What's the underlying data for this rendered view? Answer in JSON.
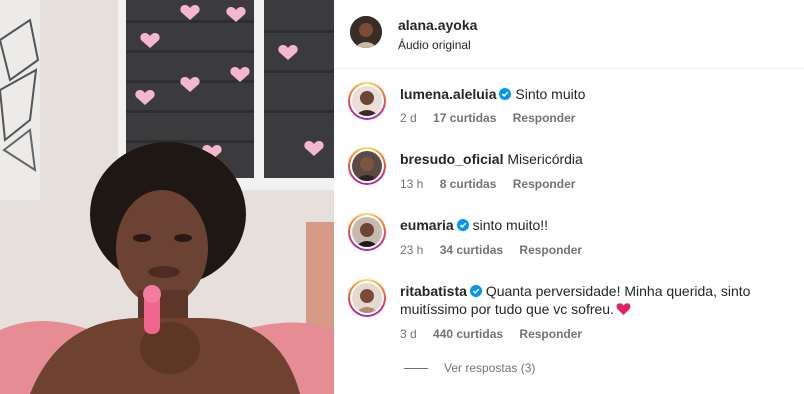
{
  "header": {
    "username": "alana.ayoka",
    "audio": "Áudio original"
  },
  "comments": [
    {
      "username": "lumena.aleluia",
      "verified": true,
      "text": "Sinto muito",
      "time": "2 d",
      "likes": "17 curtidas",
      "reply": "Responder"
    },
    {
      "username": "bresudo_oficial",
      "verified": false,
      "text": "Misericórdia",
      "time": "13 h",
      "likes": "8 curtidas",
      "reply": "Responder"
    },
    {
      "username": "eumaria",
      "verified": true,
      "text": "sinto muito!!",
      "time": "23 h",
      "likes": "34 curtidas",
      "reply": "Responder"
    },
    {
      "username": "ritabatista",
      "verified": true,
      "text": "Quanta perversidade! Minha querida, sinto muitíssimo por tudo que vc sofreu.",
      "emoji": "red-heart-emoji",
      "time": "3 d",
      "likes": "440 curtidas",
      "reply": "Responder"
    }
  ],
  "view_replies": "Ver respostas (3)",
  "colors": {
    "verified": "#0095f6",
    "heart": "#e0245e",
    "secondary_text": "#737373"
  }
}
